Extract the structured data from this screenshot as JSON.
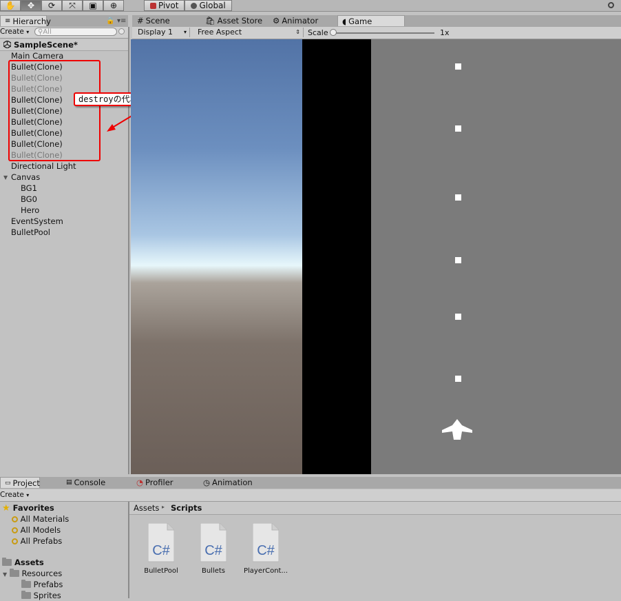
{
  "toolbar": {
    "tools": [
      "hand-tool",
      "move-tool",
      "rotate-tool",
      "scale-tool",
      "rect-tool",
      "transform-tool"
    ],
    "pivot_label": "Pivot",
    "global_label": "Global"
  },
  "hierarchy": {
    "tab_label": "Hierarchy",
    "create_label": "Create",
    "search_placeholder": "All",
    "scene_name": "SampleScene*",
    "items": [
      {
        "label": "Main Camera"
      },
      {
        "label": "Bullet(Clone)"
      },
      {
        "label": "Bullet(Clone)"
      },
      {
        "label": "Bullet(Clone)"
      },
      {
        "label": "Bullet(Clone)"
      },
      {
        "label": "Bullet(Clone)"
      },
      {
        "label": "Bullet(Clone)"
      },
      {
        "label": "Bullet(Clone)"
      },
      {
        "label": "Bullet(Clone)"
      },
      {
        "label": "Bullet(Clone)"
      },
      {
        "label": "Directional Light"
      },
      {
        "label": "Canvas"
      },
      {
        "label": "BG1"
      },
      {
        "label": "BG0"
      },
      {
        "label": "Hero"
      },
      {
        "label": "EventSystem"
      },
      {
        "label": "BulletPool"
      }
    ]
  },
  "annotation": {
    "text": "destroyの代わりに、隠しました。"
  },
  "view_tabs": {
    "scene": "Scene",
    "asset_store": "Asset Store",
    "animator": "Animator",
    "game": "Game"
  },
  "game_toolbar": {
    "display": "Display 1",
    "aspect": "Free Aspect",
    "scale_label": "Scale",
    "scale_value": "1x"
  },
  "bottom_tabs": {
    "project": "Project",
    "console": "Console",
    "profiler": "Profiler",
    "animation": "Animation"
  },
  "project": {
    "create_label": "Create",
    "favorites_label": "Favorites",
    "favorites": [
      "All Materials",
      "All Models",
      "All Prefabs"
    ],
    "assets_label": "Assets",
    "folders": [
      "Resources",
      "Prefabs",
      "Sprites"
    ],
    "breadcrumb_root": "Assets",
    "breadcrumb_current": "Scripts",
    "files": [
      "BulletPool",
      "Bullets",
      "PlayerCont..."
    ],
    "file_icon_text": "C#"
  },
  "colors": {
    "annotation_red": "#e00000",
    "cs_blue": "#4a6fb0"
  }
}
